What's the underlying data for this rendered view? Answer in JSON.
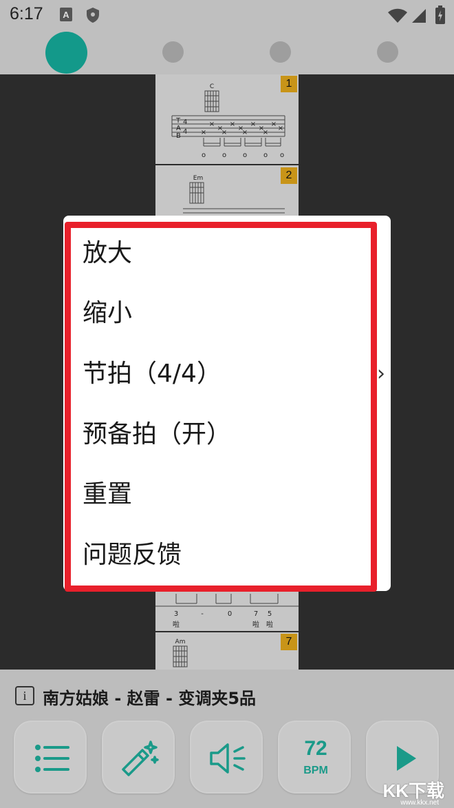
{
  "status_bar": {
    "time": "6:17",
    "icons": [
      "font-a-icon",
      "shield-icon",
      "wifi-icon",
      "signal-icon",
      "battery-charging-icon"
    ]
  },
  "pager": {
    "count": 4,
    "active_index": 0,
    "active_color": "#13998a"
  },
  "score": {
    "measures": [
      {
        "number": "1",
        "chord": "C"
      },
      {
        "number": "2",
        "chord": "Em"
      },
      {
        "number": "",
        "chord": "",
        "lyrics": [
          "啦",
          "啦",
          "啦"
        ],
        "notes": [
          "3",
          "-",
          "0",
          "7",
          "5"
        ]
      },
      {
        "number": "7",
        "chord": "Am"
      }
    ],
    "tab_letters": [
      "T",
      "A",
      "B"
    ],
    "time_sig": [
      "4",
      "4"
    ]
  },
  "menu": {
    "items": [
      {
        "label": "放大",
        "has_submenu": false
      },
      {
        "label": "缩小",
        "has_submenu": false
      },
      {
        "label": "节拍（4/4）",
        "has_submenu": true
      },
      {
        "label": "预备拍（开）",
        "has_submenu": false
      },
      {
        "label": "重置",
        "has_submenu": false
      },
      {
        "label": "问题反馈",
        "has_submenu": false
      }
    ],
    "chevron": "›",
    "highlight_color": "#e8202b"
  },
  "bottom": {
    "info_glyph": "i",
    "song_title": "南方姑娘 - 赵雷 - 变调夹5品",
    "buttons": [
      "list-icon",
      "magic-wand-icon",
      "speaker-icon",
      "bpm",
      "play-icon"
    ],
    "bpm_value": "72",
    "bpm_label": "BPM",
    "accent": "#1a9a89"
  },
  "watermark": {
    "text": "KK下载",
    "url": "www.kkx.net"
  }
}
